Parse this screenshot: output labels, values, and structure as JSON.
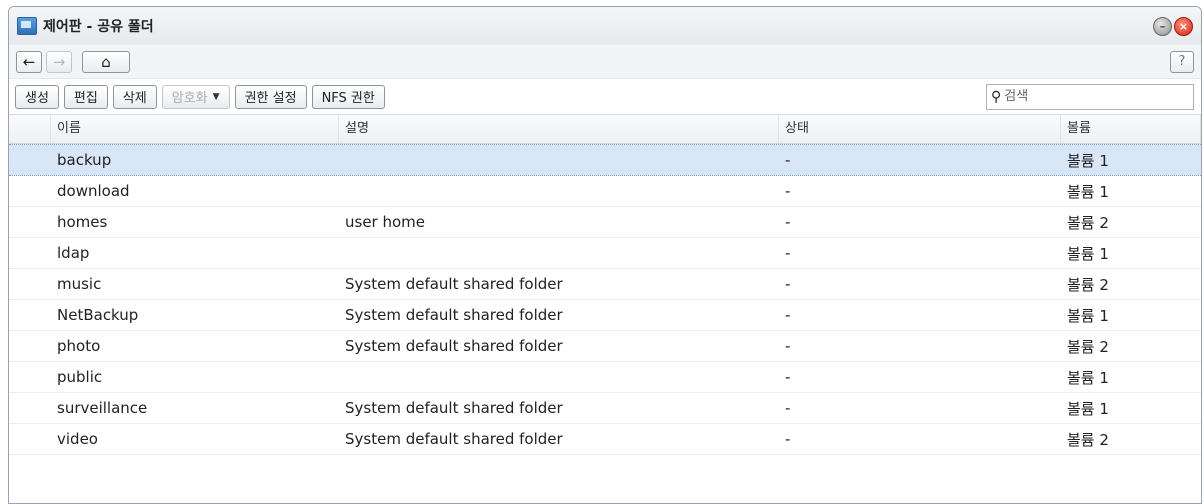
{
  "window": {
    "title": "제어판 - 공유 폴더"
  },
  "nav": {
    "back": "←",
    "forward": "→",
    "home": "⌂",
    "help": "?"
  },
  "toolbar": {
    "create": "생성",
    "edit": "편집",
    "delete": "삭제",
    "encrypt": "암호화",
    "permissions": "권한 설정",
    "nfs": "NFS 권한",
    "search_placeholder": "검색"
  },
  "table": {
    "columns": [
      "이름",
      "설명",
      "상태",
      "볼륨"
    ],
    "rows": [
      {
        "name": "backup",
        "desc": "",
        "status": "-",
        "volume": "볼륨 1"
      },
      {
        "name": "download",
        "desc": "",
        "status": "-",
        "volume": "볼륨 1"
      },
      {
        "name": "homes",
        "desc": "user home",
        "status": "-",
        "volume": "볼륨 2"
      },
      {
        "name": "ldap",
        "desc": "",
        "status": "-",
        "volume": "볼륨 1"
      },
      {
        "name": "music",
        "desc": "System default shared folder",
        "status": "-",
        "volume": "볼륨 2"
      },
      {
        "name": "NetBackup",
        "desc": "System default shared folder",
        "status": "-",
        "volume": "볼륨 1"
      },
      {
        "name": "photo",
        "desc": "System default shared folder",
        "status": "-",
        "volume": "볼륨 2"
      },
      {
        "name": "public",
        "desc": "",
        "status": "-",
        "volume": "볼륨 1"
      },
      {
        "name": "surveillance",
        "desc": "System default shared folder",
        "status": "-",
        "volume": "볼륨 1"
      },
      {
        "name": "video",
        "desc": "System default shared folder",
        "status": "-",
        "volume": "볼륨 2"
      }
    ]
  },
  "colors": {
    "selected_row": "#d8e6f7",
    "close": "#d12a1a"
  }
}
